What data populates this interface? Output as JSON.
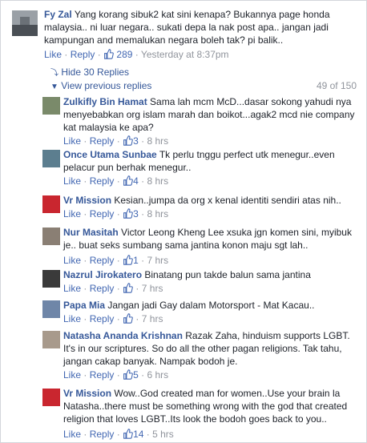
{
  "top_comment": {
    "author": "Fy Zal",
    "text": "Yang korang sibuk2 kat sini kenapa? Bukannya page honda malaysia.. ni luar negara.. sukati depa la nak post apa.. jangan jadi kampungan and memalukan negara boleh tak? pi balik..",
    "like": "Like",
    "reply": "Reply",
    "likes": "289",
    "time": "Yesterday at 8:37pm"
  },
  "controls": {
    "hide_label": "Hide 30 Replies",
    "previous_label": "View previous replies",
    "count_label": "49 of 150"
  },
  "replies": [
    {
      "author": "Zulkifly Bin Hamat",
      "text": "Sama lah mcm McD...dasar sokong yahudi nya menyebabkan org islam marah dan boikot...agak2 mcd nie company kat malaysia ke apa?",
      "likes": "3",
      "time": "8 hrs",
      "avatar_color": "#7a8a6a"
    },
    {
      "author": "Once Utama Sunbae",
      "text": "Tk perlu tnggu perfect utk menegur..even pelacur pun berhak menegur..",
      "likes": "4",
      "time": "8 hrs",
      "avatar_color": "#5c7e8f"
    },
    {
      "author": "Vr Mission",
      "text": "Kesian..jumpa da org x kenal identiti sendiri atas nih..",
      "likes": "3",
      "time": "8 hrs",
      "avatar_color": "#c9262f"
    },
    {
      "author": "Nur Masitah",
      "text": "Victor Leong Kheng Lee xsuka jgn komen sini, myibuk je.. buat seks sumbang sama jantina konon maju sgt lah..",
      "likes": "1",
      "time": "7 hrs",
      "avatar_color": "#8a7f74"
    },
    {
      "author": "Nazrul Jirokatero",
      "text": "Binatang pun takde balun sama jantina",
      "likes": "",
      "time": "7 hrs",
      "avatar_color": "#3a3a3a"
    },
    {
      "author": "Papa Mia",
      "text": "Jangan jadi Gay dalam Motorsport - Mat Kacau..",
      "likes": "",
      "time": "7 hrs",
      "avatar_color": "#6f86a8"
    },
    {
      "author": "Natasha Ananda Krishnan",
      "text": "Razak Zaha, hinduism supports LGBT. It's in our scriptures. So do all the other pagan religions. Tak tahu, jangan cakap banyak. Nampak bodoh je.",
      "likes": "5",
      "time": "6 hrs",
      "avatar_color": "#a89a8c"
    },
    {
      "author": "Vr Mission",
      "text": "Wow..God created man for women..Use your brain la Natasha..there must be something wrong with the god that created religion that loves LGBT..Its look the bodoh goes back to you..",
      "likes": "14",
      "time": "5 hrs",
      "avatar_color": "#c9262f"
    }
  ],
  "labels": {
    "like": "Like",
    "reply": "Reply",
    "sep": "·"
  }
}
